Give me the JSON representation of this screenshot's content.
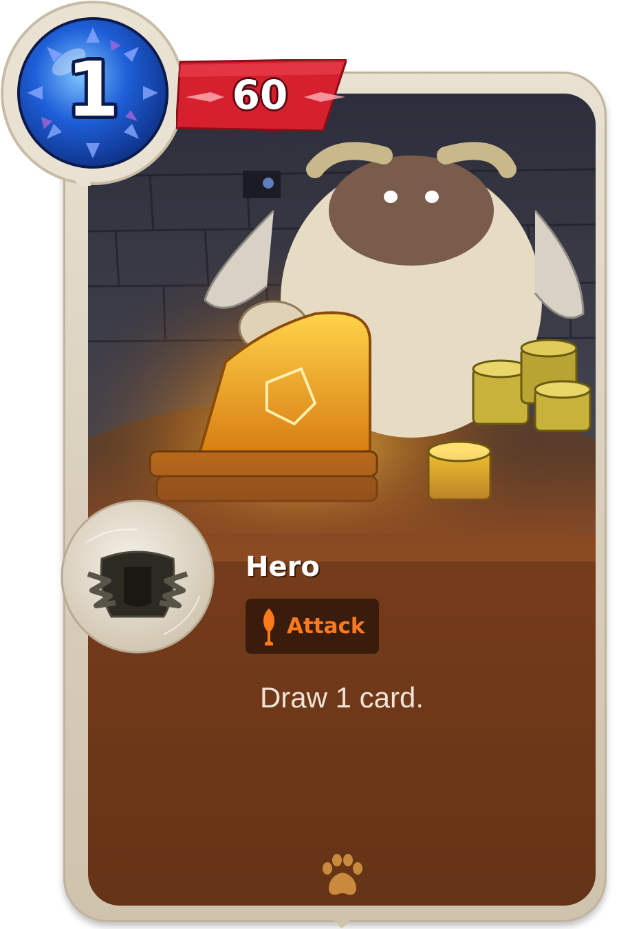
{
  "card": {
    "cost": "1",
    "attack": "60",
    "name": "Hero",
    "type_label": "Attack",
    "text": "Draw 1 card."
  },
  "icons": {
    "cost_gem": "mana-gem-icon",
    "attack": "sword-icon",
    "class": "hero-helmet-icon",
    "type": "flame-sword-icon",
    "set": "paw-print-icon"
  },
  "colors": {
    "card_body": "#7a3f1d",
    "frame": "#d9cfbc",
    "cost_gem": "#1e5fd8",
    "attack_banner": "#d6202e",
    "type_label": "#ff7a1a",
    "type_tag_bg": "#3a1c0c",
    "set_icon": "#c98a3e"
  }
}
